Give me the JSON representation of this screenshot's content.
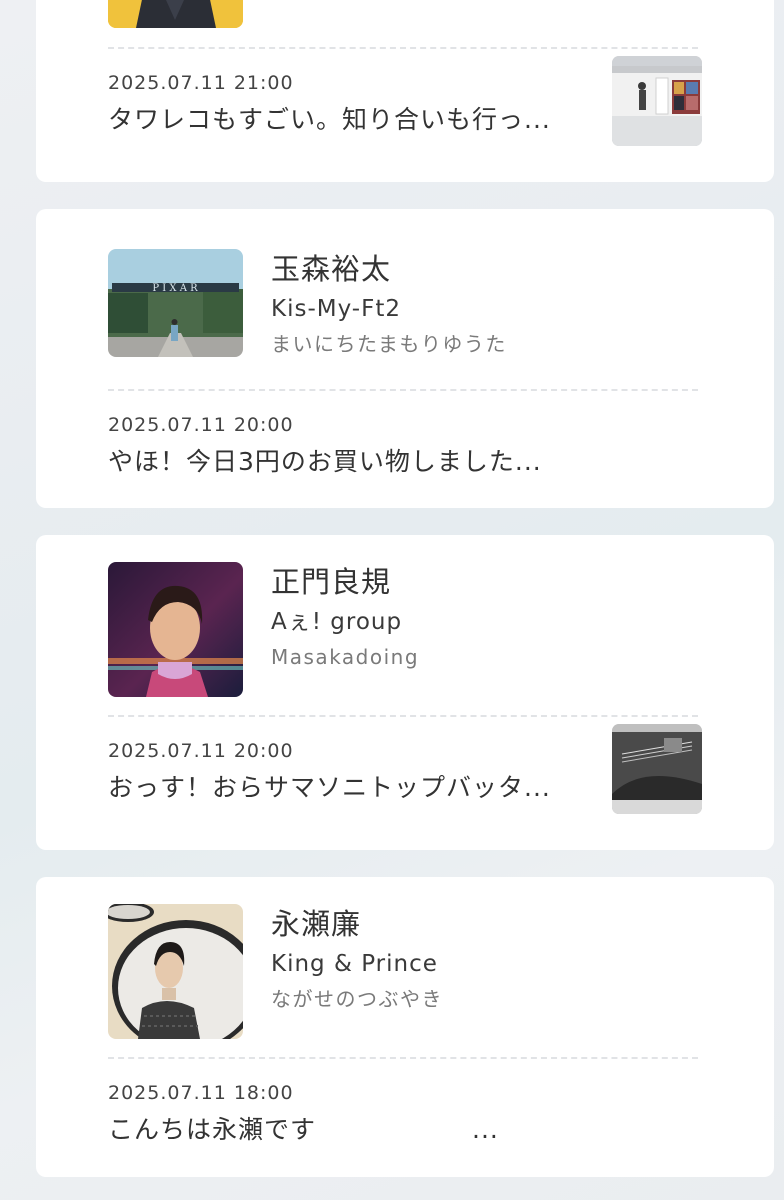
{
  "cards": [
    {
      "name": "",
      "group": "",
      "blog_title": "",
      "avatar_icon": "member-photo-yellow",
      "post": {
        "date": "2025.07.11 21:00",
        "text": "タワレコもすごい。知り合いも行っ...",
        "thumb_icon": "store-display-photo"
      }
    },
    {
      "name": "玉森裕太",
      "group": "Kis-My-Ft2",
      "blog_title": "まいにちたまもりゆうた",
      "avatar_icon": "pixar-gate-photo",
      "avatar_sign": "P I X A R",
      "post": {
        "date": "2025.07.11 20:00",
        "text": "やほ！今日3円のお買い物しました..."
      }
    },
    {
      "name": "正門良規",
      "group": "Aぇ! group",
      "blog_title": "Masakadoing",
      "avatar_icon": "portrait-photo-neon",
      "post": {
        "date": "2025.07.11 20:00",
        "text": "おっす！おらサマソニトップバッタ...",
        "thumb_icon": "guitar-photo"
      }
    },
    {
      "name": "永瀬廉",
      "group": "King & Prince",
      "blog_title": "ながせのつぶやき",
      "avatar_icon": "portrait-photo-mirror",
      "post": {
        "date": "2025.07.11 18:00",
        "text": "こんちは永瀬です　　　　　　..."
      }
    }
  ]
}
